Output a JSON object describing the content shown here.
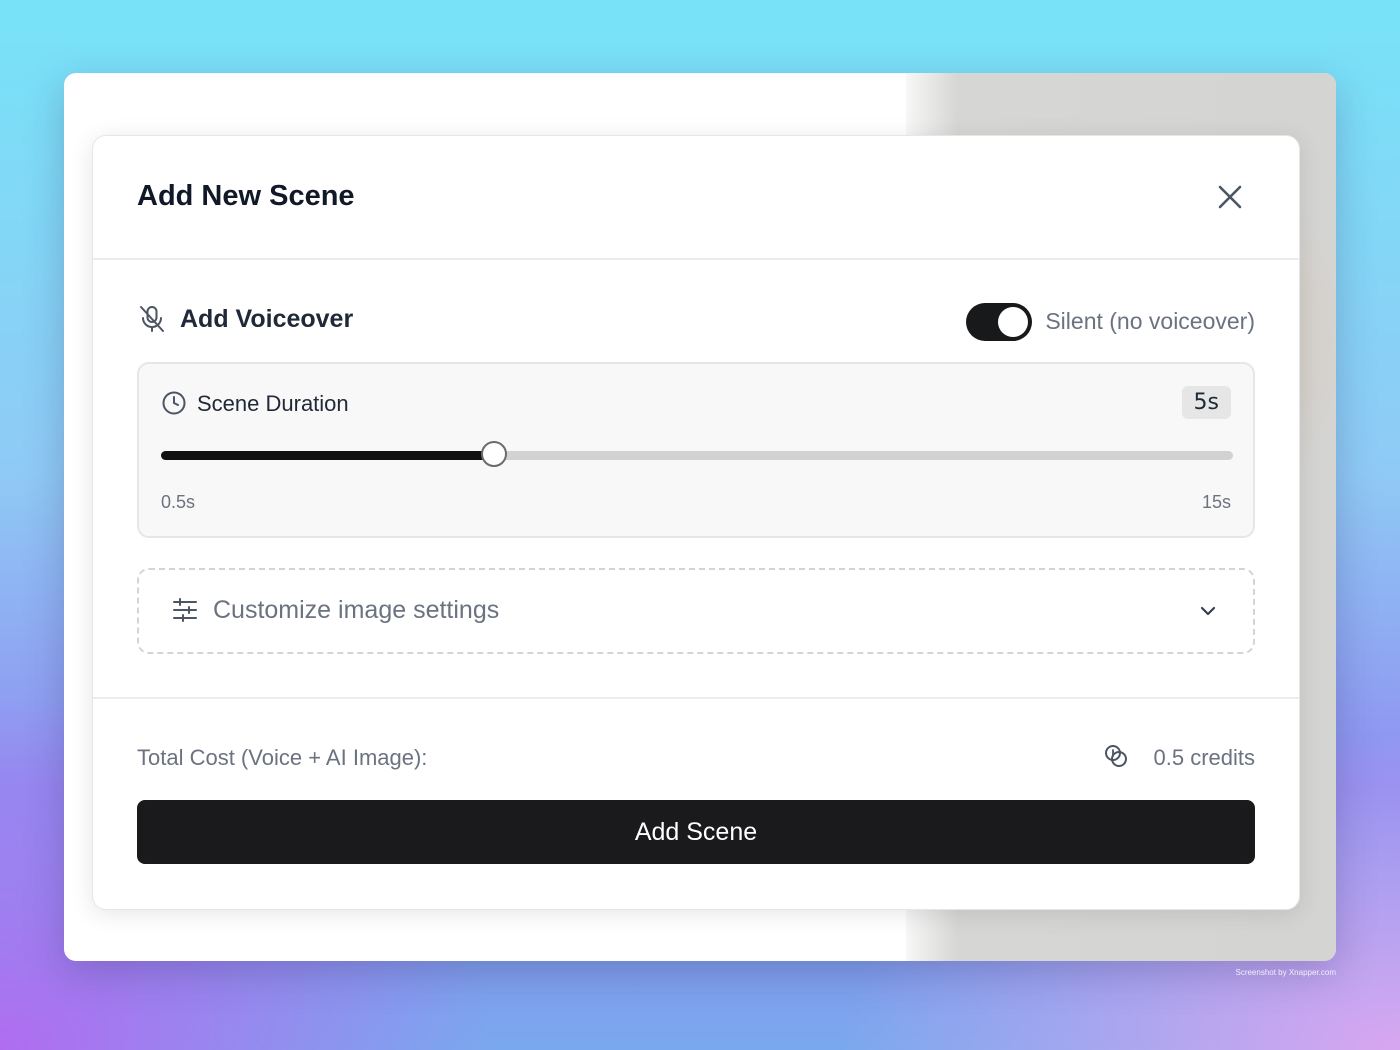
{
  "modal": {
    "title": "Add New Scene",
    "close_icon": "close-icon"
  },
  "voiceover": {
    "label": "Add Voiceover",
    "icon": "microphone-off-icon",
    "toggle_on": true,
    "toggle_label": "Silent (no voiceover)"
  },
  "duration": {
    "label": "Scene Duration",
    "icon": "clock-icon",
    "value_label": "5s",
    "value": 5,
    "min_label": "0.5s",
    "max_label": "15s",
    "min": 0.5,
    "max": 15
  },
  "customize": {
    "label": "Customize image settings",
    "icon": "sliders-icon",
    "chevron": "chevron-down-icon"
  },
  "cost": {
    "label": "Total Cost (Voice + AI Image):",
    "icon": "coins-icon",
    "value": "0.5 credits"
  },
  "actions": {
    "add_label": "Add Scene"
  },
  "watermark": "Screenshot by Xnapper.com",
  "colors": {
    "primary": "#1a1a1c",
    "muted_text": "#6b7280",
    "heading": "#111827"
  }
}
